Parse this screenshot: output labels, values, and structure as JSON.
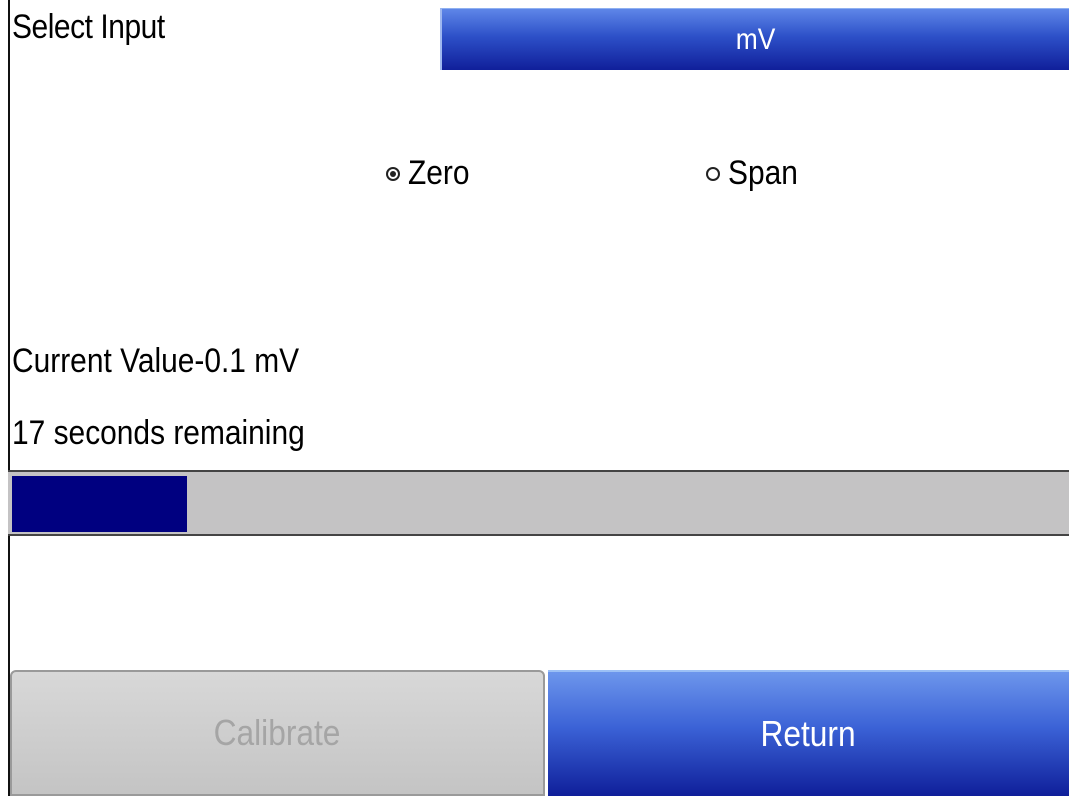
{
  "select_input": {
    "label": "Select Input",
    "value": "mV"
  },
  "mode": {
    "options": [
      {
        "label": "Zero",
        "checked": true
      },
      {
        "label": "Span",
        "checked": false
      }
    ]
  },
  "status": {
    "current_value": "Current Value-0.1 mV",
    "remaining": "17 seconds remaining",
    "progress_fraction": 0.166
  },
  "buttons": {
    "calibrate": "Calibrate",
    "return": "Return"
  },
  "colors": {
    "progress_fill": "#000080",
    "progress_track": "#c4c3c4",
    "button_active": "#2d50c8",
    "button_disabled": "#c4c4c4"
  }
}
